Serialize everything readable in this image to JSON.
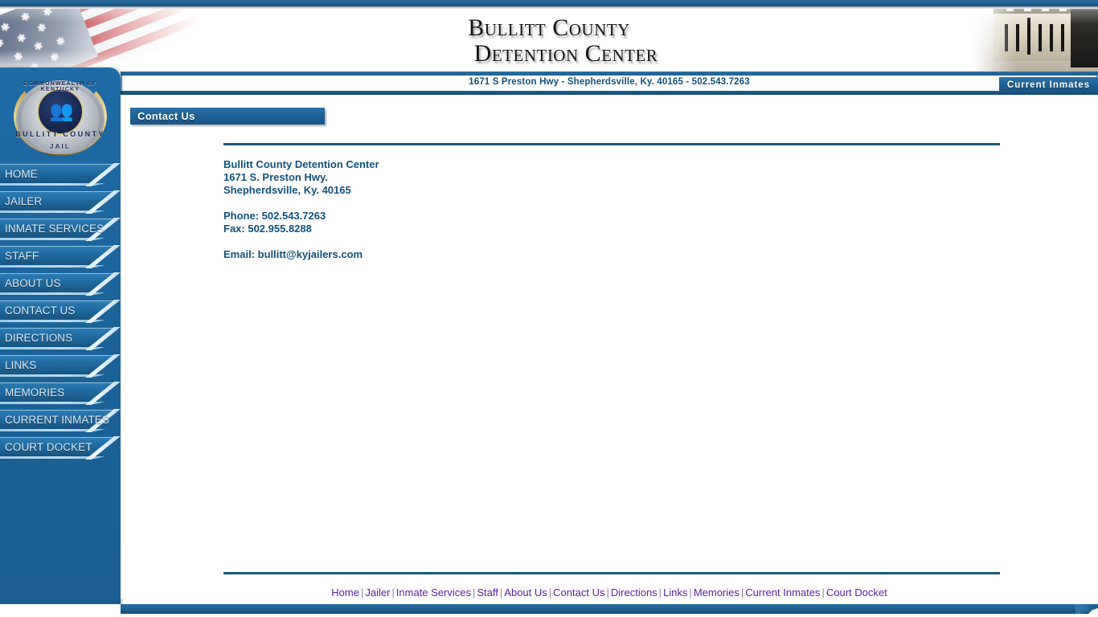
{
  "site": {
    "title_line1": "Bullitt County",
    "title_line2": "Detention Center",
    "address_strip": "1671 S Preston Hwy - Shepherdsville, Ky. 40165 - 502.543.7263",
    "current_inmates_button": "Current Inmates",
    "seal": {
      "arc_top": "COMMONWEALTH OF KENTUCKY",
      "arc_mid": "BULLITT COUNTY",
      "arc_bottom": "JAIL"
    }
  },
  "sidebar": {
    "items": [
      {
        "label": "HOME"
      },
      {
        "label": "JAILER"
      },
      {
        "label": "INMATE SERVICES"
      },
      {
        "label": "STAFF"
      },
      {
        "label": "ABOUT US"
      },
      {
        "label": "CONTACT US"
      },
      {
        "label": "DIRECTIONS"
      },
      {
        "label": "LINKS"
      },
      {
        "label": "MEMORIES"
      },
      {
        "label": "CURRENT INMATES"
      },
      {
        "label": "COURT DOCKET"
      }
    ]
  },
  "main": {
    "page_title": "Contact Us",
    "contact": {
      "name": "Bullitt County Detention Center",
      "street": "1671 S. Preston Hwy.",
      "city_state_zip": "Shepherdsville, Ky. 40165",
      "phone": "Phone: 502.543.7263",
      "fax": "Fax: 502.955.8288",
      "email_label": "Email: ",
      "email": "bullitt@kyjailers.com"
    }
  },
  "footer": {
    "links": [
      "Home",
      "Jailer",
      "Inmate Services",
      "Staff",
      "About Us",
      "Contact Us",
      "Directions",
      "Links",
      "Memories",
      "Current Inmates",
      "Court Docket"
    ],
    "separator": "|"
  },
  "colors": {
    "brand_blue": "#1b5f93",
    "sidebar_blue": "#1c6399",
    "rule_blue": "#1b5a7d",
    "text_blue": "#11517d",
    "link_purple": "#5b21a8"
  }
}
